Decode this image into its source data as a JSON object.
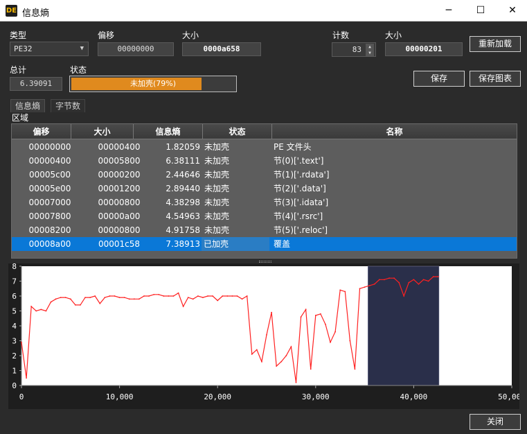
{
  "window": {
    "title": "信息熵",
    "icon_text": "DE",
    "minimize": "─",
    "maximize": "☐",
    "close": "✕"
  },
  "type_label": "类型",
  "type_value": "PE32",
  "offset_label": "偏移",
  "offset_value": "00000000",
  "size_label": "大小",
  "size_value": "0000a658",
  "count_label": "计数",
  "count_value": "83",
  "size2_label": "大小",
  "size2_value": "00000201",
  "reload_button": "重新加载",
  "total_label": "总计",
  "total_value": "6.39091",
  "status_label": "状态",
  "status_progress": {
    "text": "未加壳(79%)",
    "fraction": 0.79,
    "color": "#e08a1e"
  },
  "save_button": "保存",
  "save_chart_button": "保存图表",
  "tabs": [
    {
      "label": "信息熵"
    },
    {
      "label": "字节数"
    }
  ],
  "region_label": "区域",
  "table": {
    "columns": [
      "偏移",
      "大小",
      "信息熵",
      "状态",
      "名称"
    ],
    "rows": [
      {
        "offset": "00000000",
        "size": "00000400",
        "entropy": "1.82059",
        "status": "未加壳",
        "name": "PE 文件头"
      },
      {
        "offset": "00000400",
        "size": "00005800",
        "entropy": "6.38111",
        "status": "未加壳",
        "name": "节(0)['.text']"
      },
      {
        "offset": "00005c00",
        "size": "00000200",
        "entropy": "2.44646",
        "status": "未加壳",
        "name": "节(1)['.rdata']"
      },
      {
        "offset": "00005e00",
        "size": "00001200",
        "entropy": "2.89440",
        "status": "未加壳",
        "name": "节(2)['.data']"
      },
      {
        "offset": "00007000",
        "size": "00000800",
        "entropy": "4.38298",
        "status": "未加壳",
        "name": "节(3)['.idata']"
      },
      {
        "offset": "00007800",
        "size": "00000a00",
        "entropy": "4.54963",
        "status": "未加壳",
        "name": "节(4)['.rsrc']"
      },
      {
        "offset": "00008200",
        "size": "00000800",
        "entropy": "4.91758",
        "status": "未加壳",
        "name": "节(5)['.reloc']"
      },
      {
        "offset": "00008a00",
        "size": "00001c58",
        "entropy": "7.38913",
        "status": "已加壳",
        "name": "覆盖",
        "selected": true
      }
    ]
  },
  "chart_data": {
    "type": "line",
    "xlim": [
      0,
      50000
    ],
    "ylim": [
      0,
      8
    ],
    "xticks": [
      "0",
      "10,000",
      "20,000",
      "30,000",
      "40,000",
      "50,000"
    ],
    "yticks": [
      "0",
      "1",
      "2",
      "3",
      "4",
      "5",
      "6",
      "7",
      "8"
    ],
    "series_color": "#ff2020",
    "highlight_range": [
      35328,
      42584
    ],
    "highlight_color": "#2a2f4a",
    "points": [
      [
        0,
        2.9
      ],
      [
        500,
        0.5
      ],
      [
        1000,
        5.3
      ],
      [
        1500,
        5.0
      ],
      [
        2000,
        5.1
      ],
      [
        2500,
        5.0
      ],
      [
        3000,
        5.6
      ],
      [
        3500,
        5.8
      ],
      [
        4000,
        5.9
      ],
      [
        4500,
        5.9
      ],
      [
        5000,
        5.8
      ],
      [
        5500,
        5.4
      ],
      [
        6000,
        5.4
      ],
      [
        6500,
        5.9
      ],
      [
        7000,
        5.9
      ],
      [
        7500,
        6.0
      ],
      [
        8000,
        5.5
      ],
      [
        8500,
        5.9
      ],
      [
        9000,
        6.0
      ],
      [
        9500,
        6.0
      ],
      [
        10000,
        5.9
      ],
      [
        10500,
        5.9
      ],
      [
        11000,
        5.8
      ],
      [
        11500,
        5.8
      ],
      [
        12000,
        5.8
      ],
      [
        12500,
        6.0
      ],
      [
        13000,
        6.0
      ],
      [
        13500,
        6.1
      ],
      [
        14000,
        6.1
      ],
      [
        14500,
        6.0
      ],
      [
        15000,
        6.0
      ],
      [
        15500,
        6.0
      ],
      [
        16000,
        6.2
      ],
      [
        16500,
        5.3
      ],
      [
        17000,
        5.9
      ],
      [
        17500,
        5.8
      ],
      [
        18000,
        6.0
      ],
      [
        18500,
        5.9
      ],
      [
        19000,
        6.0
      ],
      [
        19500,
        6.0
      ],
      [
        20000,
        5.7
      ],
      [
        20500,
        6.0
      ],
      [
        21000,
        6.0
      ],
      [
        21500,
        6.0
      ],
      [
        22000,
        6.0
      ],
      [
        22500,
        5.8
      ],
      [
        23000,
        6.0
      ],
      [
        23500,
        2.1
      ],
      [
        24000,
        2.4
      ],
      [
        24500,
        1.6
      ],
      [
        25000,
        3.4
      ],
      [
        25500,
        4.9
      ],
      [
        26000,
        1.3
      ],
      [
        26500,
        1.6
      ],
      [
        27000,
        2.0
      ],
      [
        27500,
        2.6
      ],
      [
        28000,
        0.2
      ],
      [
        28500,
        4.6
      ],
      [
        29000,
        5.1
      ],
      [
        29500,
        1.1
      ],
      [
        30000,
        4.7
      ],
      [
        30500,
        4.8
      ],
      [
        31000,
        4.1
      ],
      [
        31500,
        2.9
      ],
      [
        32000,
        3.6
      ],
      [
        32500,
        6.4
      ],
      [
        33000,
        6.3
      ],
      [
        33500,
        3.0
      ],
      [
        34000,
        1.1
      ],
      [
        34500,
        6.5
      ],
      [
        35000,
        6.6
      ],
      [
        35500,
        6.7
      ],
      [
        36000,
        6.8
      ],
      [
        36500,
        7.1
      ],
      [
        37000,
        7.1
      ],
      [
        37500,
        7.2
      ],
      [
        38000,
        7.2
      ],
      [
        38500,
        6.9
      ],
      [
        39000,
        6.0
      ],
      [
        39500,
        6.9
      ],
      [
        40000,
        7.1
      ],
      [
        40500,
        6.8
      ],
      [
        41000,
        7.1
      ],
      [
        41500,
        7.0
      ],
      [
        42000,
        7.3
      ],
      [
        42500,
        7.3
      ]
    ]
  },
  "close_button": "关闭"
}
